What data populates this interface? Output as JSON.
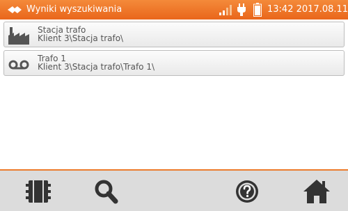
{
  "header": {
    "title": "Wyniki wyszukiwania",
    "time": "13:42",
    "date": "2017.08.11",
    "icons": [
      "app-logo-icon",
      "signal-strength-icon",
      "power-plug-icon",
      "battery-icon"
    ]
  },
  "results": [
    {
      "name": "Stacja trafo",
      "path": "Klient 3\\Stacja trafo\\",
      "icon": "factory-icon"
    },
    {
      "name": "Trafo 1",
      "path": "Klient 3\\Stacja trafo\\Trafo 1\\",
      "icon": "transformer-icon"
    }
  ],
  "toolbar": {
    "buttons": [
      "memory-card-icon",
      "search-icon",
      "help-icon",
      "home-icon"
    ]
  },
  "colors": {
    "accent": "#ec7b2c",
    "toolbar_bg": "#dcdcdc",
    "icon_dark": "#333333"
  }
}
